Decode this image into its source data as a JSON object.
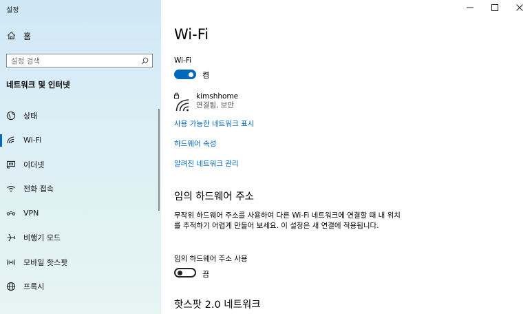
{
  "app": {
    "title": "설정"
  },
  "sidebar": {
    "home_label": "홈",
    "search_placeholder": "설정 검색",
    "section_heading": "네트워크 및 인터넷",
    "items": [
      {
        "label": "상태",
        "icon": "globe-status-icon"
      },
      {
        "label": "Wi-Fi",
        "icon": "wifi-icon",
        "selected": true
      },
      {
        "label": "이더넷",
        "icon": "ethernet-icon"
      },
      {
        "label": "전화 접속",
        "icon": "dialup-icon"
      },
      {
        "label": "VPN",
        "icon": "vpn-icon"
      },
      {
        "label": "비행기 모드",
        "icon": "airplane-icon"
      },
      {
        "label": "모바일 핫스팟",
        "icon": "hotspot-icon"
      },
      {
        "label": "프록시",
        "icon": "globe-icon"
      }
    ]
  },
  "main": {
    "title": "Wi-Fi",
    "wifi_toggle": {
      "label": "Wi-Fi",
      "state_text": "켬",
      "on": true
    },
    "network": {
      "name": "kimshhome",
      "status": "연결됨, 보안"
    },
    "links": {
      "show_available": "사용 가능한 네트워크 표시",
      "hardware_props": "하드웨어 속성",
      "manage_known": "알려진 네트워크 관리"
    },
    "random_hw": {
      "heading": "임의 하드웨어 주소",
      "description": "무작위 하드웨어 주소를 사용하여 다른 Wi-Fi 네트워크에 연결할 때 내 위치를 추적하기 어렵게 만들어 보세요. 이 설정은 새 연결에 적용됩니다.",
      "option_label": "임의 하드웨어 주소 사용",
      "state_text": "끔",
      "on": false
    },
    "hotspot_heading": "핫스팟 2.0 네트워크"
  },
  "colors": {
    "accent": "#0067c0",
    "sidebar_bg": "#d6ecf5"
  }
}
